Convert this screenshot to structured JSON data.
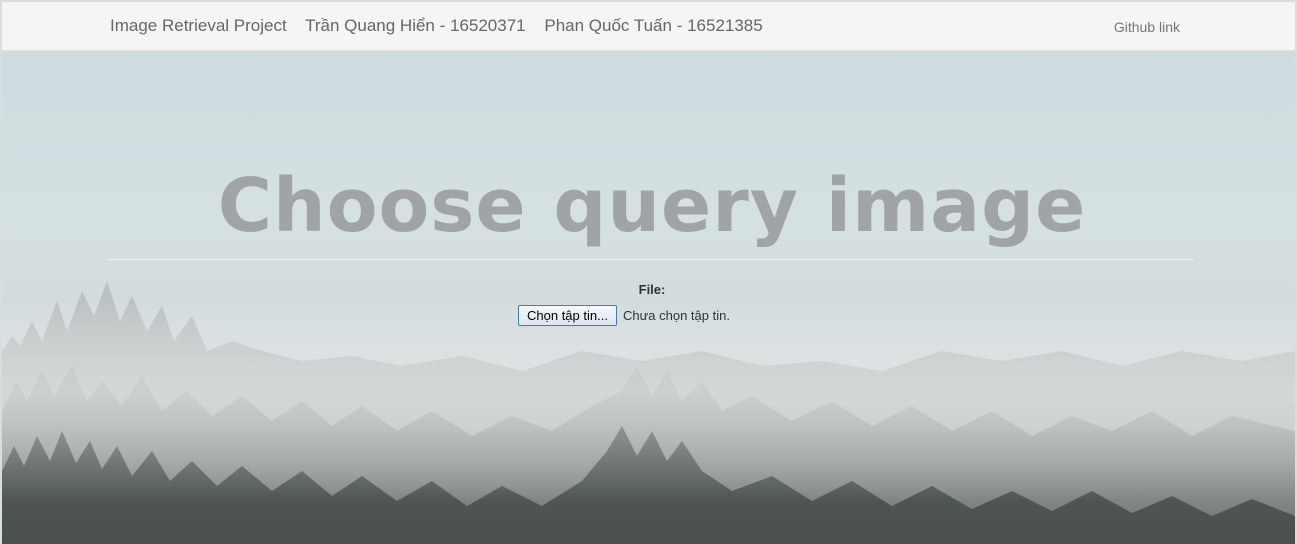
{
  "navbar": {
    "project": "Image Retrieval Project",
    "author1": "Trần Quang Hiển - 16520371",
    "author2": "Phan Quốc Tuấn - 16521385",
    "github_link": "Github link"
  },
  "main": {
    "title": "Choose query image",
    "file_label": "File:",
    "file_button": "Chọn tập tin...",
    "file_status": "Chưa chọn tập tin."
  },
  "colors": {
    "navbar_bg": "#f5f5f5",
    "title_text": "#a1a4a5",
    "sky": "#d5e0e2",
    "button_border": "#3c7fb1"
  },
  "background": {
    "subject": "foggy-pine-forest"
  }
}
